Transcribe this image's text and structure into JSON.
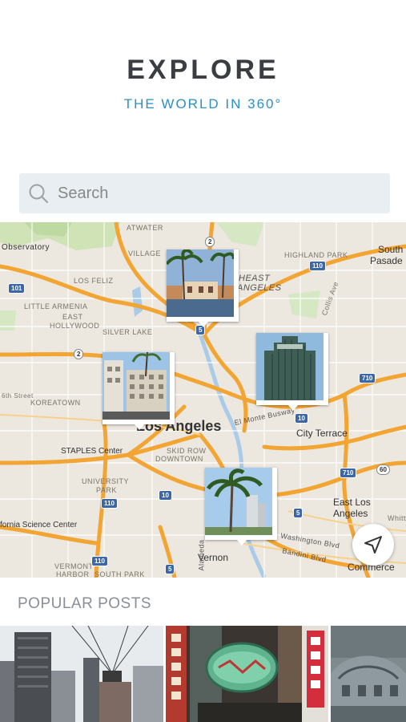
{
  "header": {
    "title": "EXPLORE",
    "subtitle": "THE WORLD IN 360°"
  },
  "search": {
    "placeholder": "Search",
    "icon": "search-icon"
  },
  "map": {
    "city_label": "Los Angeles",
    "labels": {
      "observatory": "Observatory",
      "atwater": "ATWATER",
      "village": "VILLAGE",
      "los_feliz": "LOS FELIZ",
      "little_armenia": "LITTLE ARMENIA",
      "east": "EAST",
      "hollywood": "HOLLYWOOD",
      "silver_lake": "SILVER LAKE",
      "koreatown": "KOREATOWN",
      "th_st": "6th Street",
      "staples": "STAPLES Center",
      "skid_row": "SKID ROW",
      "downtown": "DOWNTOWN",
      "university": "UNIVERSITY",
      "park": "PARK",
      "science_center": "fornia Science Center",
      "vermont": "VERMONT",
      "harbor": "HARBOR",
      "south_park": "SOUTH PARK",
      "vernon": "Vernon",
      "alameda": "Alameda",
      "highland_park": "HIGHLAND PARK",
      "south_pasadena": "South",
      "south_pasadena2": "Pasade",
      "heast": "HEAST",
      "angeles": "ANGELES",
      "collis": "Collis Ave",
      "city_terrace": "City Terrace",
      "el_monte": "El Monte Busway",
      "east_los": "East Los",
      "east_angeles": "Angeles",
      "whittier": "Whitt",
      "washington": "Washington Blvd",
      "bandini": "Bandini Blvd",
      "commerce": "Commerce"
    },
    "shields": [
      "101",
      "2",
      "5",
      "2",
      "110",
      "710",
      "10",
      "110",
      "10",
      "5",
      "710",
      "60",
      "110",
      "5"
    ],
    "locate_icon": "navigation-arrow-icon"
  },
  "popular": {
    "heading": "POPULAR POSTS"
  }
}
